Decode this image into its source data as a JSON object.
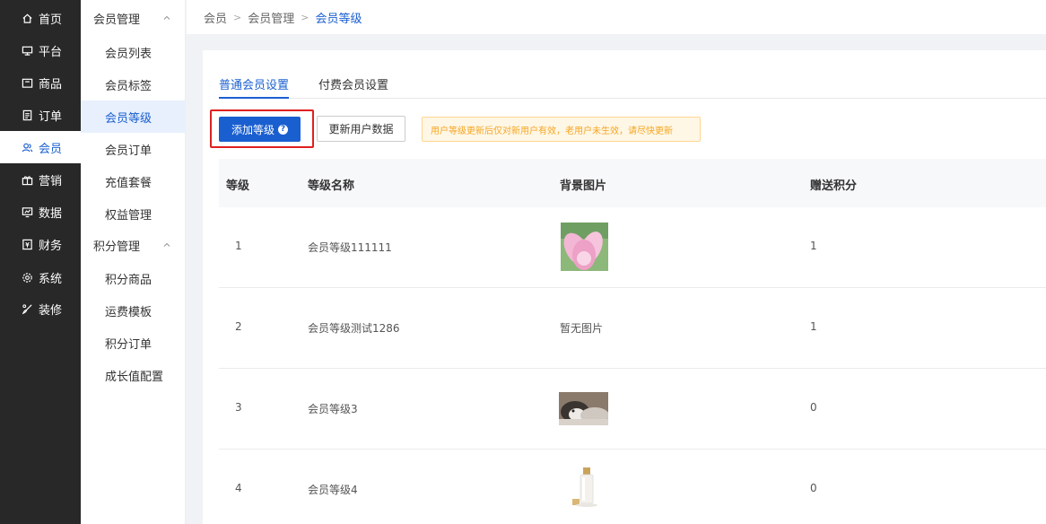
{
  "nav_primary": [
    {
      "label": "首页",
      "icon": "home-icon"
    },
    {
      "label": "平台",
      "icon": "monitor-icon"
    },
    {
      "label": "商品",
      "icon": "box-icon"
    },
    {
      "label": "订单",
      "icon": "document-icon"
    },
    {
      "label": "会员",
      "icon": "users-icon",
      "active": true
    },
    {
      "label": "营销",
      "icon": "gift-icon"
    },
    {
      "label": "数据",
      "icon": "chart-icon"
    },
    {
      "label": "财务",
      "icon": "finance-icon"
    },
    {
      "label": "系统",
      "icon": "gear-icon"
    },
    {
      "label": "装修",
      "icon": "brush-icon"
    }
  ],
  "nav_secondary": {
    "group1": {
      "label": "会员管理",
      "items": [
        "会员列表",
        "会员标签",
        "会员等级",
        "会员订单",
        "充值套餐",
        "权益管理"
      ]
    },
    "group2": {
      "label": "积分管理",
      "items": [
        "积分商品",
        "运费模板",
        "积分订单",
        "成长值配置"
      ]
    }
  },
  "breadcrumb": [
    "会员",
    "会员管理",
    "会员等级"
  ],
  "tabs": [
    "普通会员设置",
    "付费会员设置"
  ],
  "toolbar": {
    "add_label": "添加等级",
    "help_glyph": "?",
    "refresh_label": "更新用户数据",
    "notice": "用户等级更新后仅对新用户有效，老用户未生效，请尽快更新"
  },
  "table": {
    "headers": [
      "等级",
      "等级名称",
      "背景图片",
      "赠送积分"
    ],
    "rows": [
      {
        "level": "1",
        "name": "会员等级111111",
        "image": "lotus-flower-image",
        "image_text": "",
        "points": "1"
      },
      {
        "level": "2",
        "name": "会员等级测试1286",
        "image": "",
        "image_text": "暂无图片",
        "points": "1"
      },
      {
        "level": "3",
        "name": "会员等级3",
        "image": "husky-dog-image",
        "image_text": "",
        "points": "0"
      },
      {
        "level": "4",
        "name": "会员等级4",
        "image": "perfume-bottle-image",
        "image_text": "",
        "points": "0"
      }
    ]
  },
  "colors": {
    "primary": "#1a5fd0",
    "sidebar_bg": "#282828",
    "highlight": "#e02020",
    "notice_text": "#f5a623"
  }
}
